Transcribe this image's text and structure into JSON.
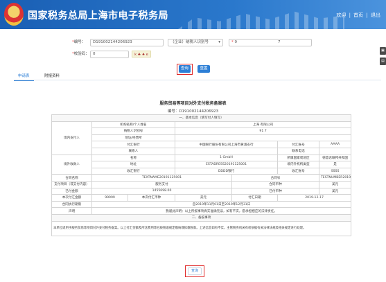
{
  "header": {
    "title": "国家税务总局上海市电子税务局",
    "welcome": "欢迎",
    "divider1": "|",
    "home": "首页",
    "divider2": "|",
    "logout": "退出"
  },
  "search": {
    "number_label": "编号：",
    "number_value": "D191002144206923",
    "tax_type_select": "（企业）纳税人识别号",
    "taxpayer_value": "9",
    "taxpayer_tail": "7",
    "captcha_label": "校验码：",
    "captcha_value": "0",
    "captcha_image": "k ♣ ♠ e",
    "query_label": "查询",
    "reset_label": "重置"
  },
  "tabs": [
    {
      "label": "申请表"
    },
    {
      "label": "附报资料"
    }
  ],
  "side_tools": [
    "▣",
    "▤"
  ],
  "sheet": {
    "title": "服务贸易等项目对外支付税务备案表",
    "number": "编号：D191002144206923",
    "section1": "一、基本信息（填写付人填写）",
    "domestic_payer": "境内支付人",
    "payer_name_label": "机构名称/个人姓名",
    "payer_name_value": "上海                            有限公司",
    "payer_taxid_label": "纳税人识别号",
    "payer_taxid_value": "91                                 7",
    "payer_addr_label": "地址/经营所",
    "payer_addr_value": "",
    "payer_bank_label": "付汇银行",
    "payer_bank_value": "中国银行股份有限公司上海市黄浦支行",
    "payer_acct_label": "付汇账号",
    "payer_acct_value": "AAAA",
    "payer_contact_label": "联系人",
    "payer_contact_value": "",
    "payer_phone_label": "联系电话",
    "payer_phone_value": "",
    "overseas_receiver": "境外收款人",
    "recv_name_label": "名称",
    "recv_name_value": "1                         GmbH",
    "recv_country_label": "所属国家或地区",
    "recv_country_value": "德意志联邦共和国",
    "recv_addr_label": "地址",
    "recv_addr_value": "ESTADRESS20191125001",
    "recv_type_label": "境内外机构类型",
    "recv_type_value": "是",
    "recv_bank_label": "收汇银行",
    "recv_bank_value": "DDDD银行",
    "recv_acct_label": "收汇账号",
    "recv_acct_value": "SSSS",
    "contract_name_label": "合同名称",
    "contract_name_value": "TEXTNAME20191125001",
    "contract_no_label": "合同号",
    "contract_no_value": "TESTNUMBER20191125001",
    "pay_item_label": "支付项目（或支付内容）",
    "pay_item_value": "服务支付",
    "pay_currency_label": "合同币种",
    "pay_currency_value": "美元",
    "paid_amount_label": "已付金额",
    "paid_amount_value": "1455698.00",
    "paid_currency_label": "已付币种",
    "paid_currency_value": "美元",
    "this_amount_label": "本次付汇金额",
    "this_amount_value": "99999",
    "this_currency_label": "本次付汇币种",
    "this_currency_value": "美元",
    "pay_date_label": "付汇日期",
    "pay_date_value": "2019-12-17",
    "period_label": "合同执行期限",
    "period_value": "自2019年11月01日至2019年12月31日",
    "remark_label": "声明",
    "remark_value": "我谨此声明：以上所报事项真实准确无误，如有不实，愿承担相应的法律责任。",
    "section2": "二、备投事项",
    "note": "本单位适用于服务贸易等项目对外支付税务备案。以上付汇金额及所含费用等已按税收规定缴纳或扣缴税款。上述信息如有不实，主管税务机关有权依据有关法律法规及相关规定进行处理。",
    "bottom_button": "查询"
  }
}
